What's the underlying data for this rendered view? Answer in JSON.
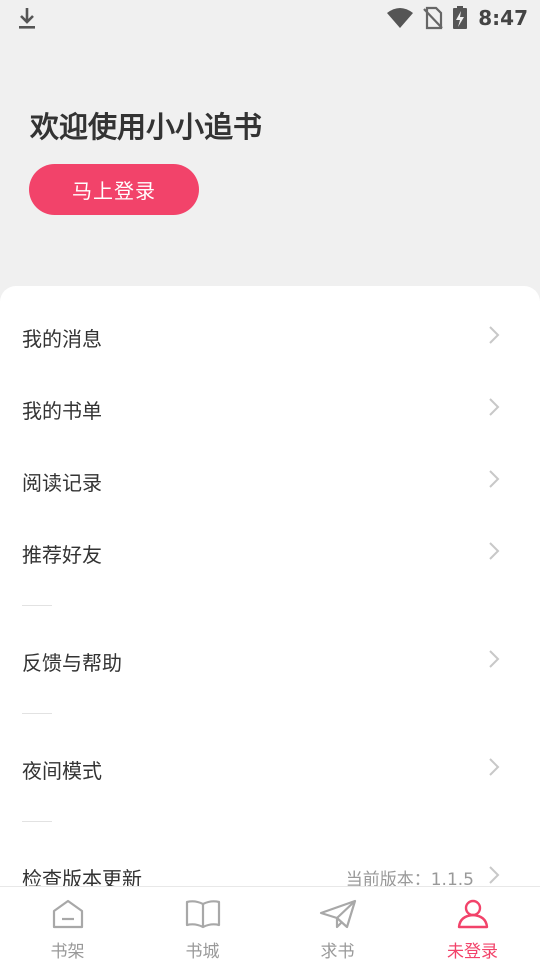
{
  "status_bar": {
    "time": "8:47",
    "icons": [
      "download-icon",
      "wifi-icon",
      "no-sim-icon",
      "battery-charging-icon"
    ]
  },
  "header": {
    "welcome": "欢迎使用小小追书",
    "login_button": "马上登录"
  },
  "menu": {
    "items": [
      {
        "label": "我的消息"
      },
      {
        "label": "我的书单"
      },
      {
        "label": "阅读记录"
      },
      {
        "label": "推荐好友"
      },
      {
        "label": "反馈与帮助"
      },
      {
        "label": "夜间模式"
      },
      {
        "label": "检查版本更新",
        "value": "当前版本：1.1.5"
      }
    ]
  },
  "tabbar": {
    "tabs": [
      {
        "label": "书架",
        "icon": "home-icon"
      },
      {
        "label": "书城",
        "icon": "book-icon"
      },
      {
        "label": "求书",
        "icon": "send-icon"
      },
      {
        "label": "未登录",
        "icon": "user-icon",
        "active": true
      }
    ]
  },
  "colors": {
    "accent": "#f2436a",
    "background": "#f0f0f0",
    "panel": "#ffffff",
    "inactive_tab": "#999999"
  }
}
